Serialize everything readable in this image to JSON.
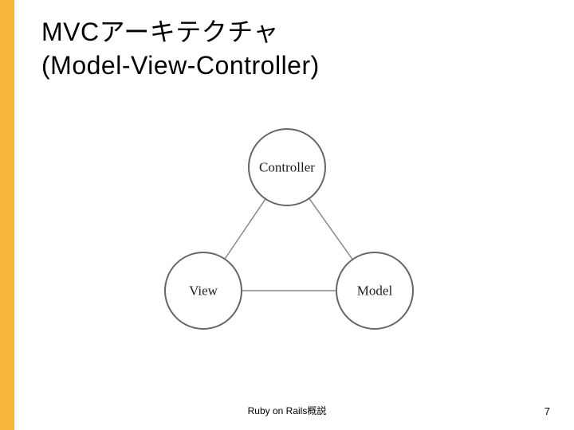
{
  "accent_color": "#f6b73c",
  "title": {
    "line1": "MVCアーキテクチャ",
    "line2": "(Model-View-Controller)"
  },
  "diagram": {
    "nodes": {
      "controller": "Controller",
      "view": "View",
      "model": "Model"
    }
  },
  "footer": {
    "center": "Ruby on Rails概説",
    "page_number": "7"
  }
}
